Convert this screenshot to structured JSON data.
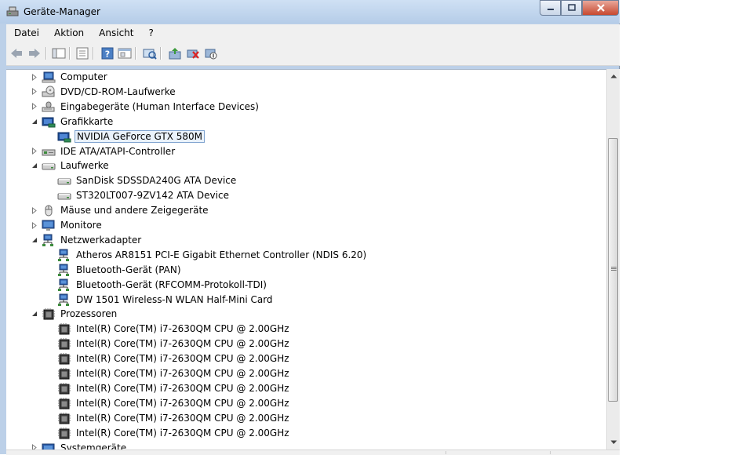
{
  "window": {
    "title": "Geräte-Manager"
  },
  "menu": [
    "Datei",
    "Aktion",
    "Ansicht",
    "?"
  ],
  "toolbar_buttons": [
    "back-arrow-icon",
    "forward-arrow-icon",
    "show-hide-tree-icon",
    "properties-icon",
    "help-icon",
    "view-icon",
    "scan-hardware-icon",
    "update-driver-icon",
    "uninstall-icon",
    "disable-device-icon"
  ],
  "tree": [
    {
      "label": "Computer",
      "level": 0,
      "expander": "collapsed",
      "icon": "computer-icon"
    },
    {
      "label": "DVD/CD-ROM-Laufwerke",
      "level": 0,
      "expander": "collapsed",
      "icon": "dvd-drive-icon"
    },
    {
      "label": "Eingabegeräte (Human Interface Devices)",
      "level": 0,
      "expander": "collapsed",
      "icon": "hid-icon"
    },
    {
      "label": "Grafikkarte",
      "level": 0,
      "expander": "expanded",
      "icon": "display-adapter-icon"
    },
    {
      "label": "NVIDIA GeForce GTX 580M",
      "level": 1,
      "expander": "none",
      "icon": "display-adapter-icon",
      "selected": true
    },
    {
      "label": "IDE ATA/ATAPI-Controller",
      "level": 0,
      "expander": "collapsed",
      "icon": "ide-controller-icon"
    },
    {
      "label": "Laufwerke",
      "level": 0,
      "expander": "expanded",
      "icon": "disk-drive-icon"
    },
    {
      "label": "SanDisk SDSSDA240G ATA Device",
      "level": 1,
      "expander": "none",
      "icon": "disk-drive-icon"
    },
    {
      "label": "ST320LT007-9ZV142 ATA Device",
      "level": 1,
      "expander": "none",
      "icon": "disk-drive-icon"
    },
    {
      "label": "Mäuse und andere Zeigegeräte",
      "level": 0,
      "expander": "collapsed",
      "icon": "mouse-icon"
    },
    {
      "label": "Monitore",
      "level": 0,
      "expander": "collapsed",
      "icon": "monitor-icon"
    },
    {
      "label": "Netzwerkadapter",
      "level": 0,
      "expander": "expanded",
      "icon": "network-adapter-icon"
    },
    {
      "label": "Atheros AR8151 PCI-E Gigabit Ethernet Controller (NDIS 6.20)",
      "level": 1,
      "expander": "none",
      "icon": "network-adapter-icon"
    },
    {
      "label": "Bluetooth-Gerät (PAN)",
      "level": 1,
      "expander": "none",
      "icon": "network-adapter-icon"
    },
    {
      "label": "Bluetooth-Gerät (RFCOMM-Protokoll-TDI)",
      "level": 1,
      "expander": "none",
      "icon": "network-adapter-icon"
    },
    {
      "label": "DW 1501 Wireless-N WLAN Half-Mini Card",
      "level": 1,
      "expander": "none",
      "icon": "network-adapter-icon"
    },
    {
      "label": "Prozessoren",
      "level": 0,
      "expander": "expanded",
      "icon": "processor-icon"
    },
    {
      "label": "Intel(R) Core(TM) i7-2630QM CPU @ 2.00GHz",
      "level": 1,
      "expander": "none",
      "icon": "processor-icon"
    },
    {
      "label": "Intel(R) Core(TM) i7-2630QM CPU @ 2.00GHz",
      "level": 1,
      "expander": "none",
      "icon": "processor-icon"
    },
    {
      "label": "Intel(R) Core(TM) i7-2630QM CPU @ 2.00GHz",
      "level": 1,
      "expander": "none",
      "icon": "processor-icon"
    },
    {
      "label": "Intel(R) Core(TM) i7-2630QM CPU @ 2.00GHz",
      "level": 1,
      "expander": "none",
      "icon": "processor-icon"
    },
    {
      "label": "Intel(R) Core(TM) i7-2630QM CPU @ 2.00GHz",
      "level": 1,
      "expander": "none",
      "icon": "processor-icon"
    },
    {
      "label": "Intel(R) Core(TM) i7-2630QM CPU @ 2.00GHz",
      "level": 1,
      "expander": "none",
      "icon": "processor-icon"
    },
    {
      "label": "Intel(R) Core(TM) i7-2630QM CPU @ 2.00GHz",
      "level": 1,
      "expander": "none",
      "icon": "processor-icon"
    },
    {
      "label": "Intel(R) Core(TM) i7-2630QM CPU @ 2.00GHz",
      "level": 1,
      "expander": "none",
      "icon": "processor-icon"
    },
    {
      "label": "Systemgeräte",
      "level": 0,
      "expander": "collapsed",
      "icon": "system-device-icon"
    }
  ]
}
